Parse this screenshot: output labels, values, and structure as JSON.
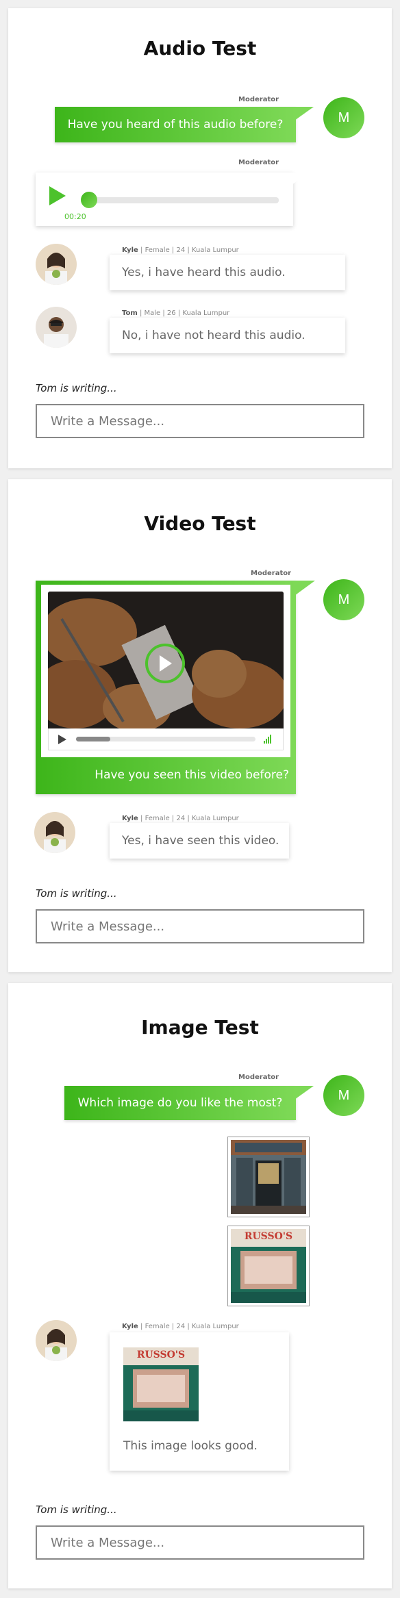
{
  "audio_test": {
    "title": "Audio Test",
    "moderator_label_1": "Moderator",
    "question": "Have you heard of this audio before?",
    "avatar_letter": "M",
    "moderator_label_2": "Moderator",
    "audio_time": "00:20",
    "audio_progress": 0,
    "reply_1": {
      "name": "Kyle",
      "details": " | Female | 24 | Kuala Lumpur",
      "text": "Yes, i have heard this audio."
    },
    "reply_2": {
      "name": "Tom",
      "details": " | Male | 26 | Kuala Lumpur",
      "text": "No, i have not heard this audio."
    },
    "writing": "Tom is writing...",
    "input_placeholder": "Write a Message..."
  },
  "video_test": {
    "title": "Video Test",
    "moderator_label": "Moderator",
    "avatar_letter": "M",
    "question": "Have you seen this video before?",
    "video_progress": 0.19,
    "reply_1": {
      "name": "Kyle",
      "details": " | Female | 24 | Kuala Lumpur",
      "text": "Yes, i have seen this video."
    },
    "writing": "Tom is writing...",
    "input_placeholder": "Write a Message..."
  },
  "image_test": {
    "title": "Image Test",
    "moderator_label": "Moderator",
    "avatar_letter": "M",
    "question": "Which image do you like the most?",
    "image_2_sign": "RUSSO'S",
    "reply_1": {
      "name": "Kyle",
      "details": " | Female | 24 | Kuala Lumpur",
      "text": "This image looks good.",
      "image_sign": "RUSSO'S"
    },
    "writing": "Tom is writing...",
    "input_placeholder": "Write a Message..."
  },
  "colors": {
    "accent": "#4cc22c",
    "accent_light": "#7ed957"
  }
}
